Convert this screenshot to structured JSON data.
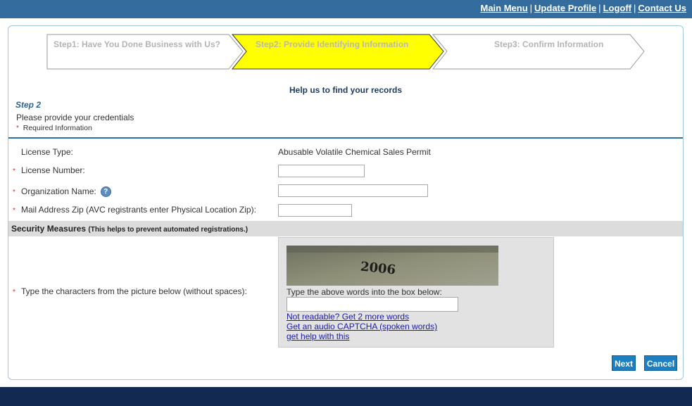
{
  "topnav": {
    "links": [
      "Main Menu",
      "Update Profile",
      "Logoff",
      "Contact Us"
    ],
    "separator": "|"
  },
  "steps": [
    {
      "label": "Step1: Have You Done Business with Us?",
      "state": "done"
    },
    {
      "label": "Step2: Provide Identifying Information",
      "state": "active",
      "color": "#ffff00"
    },
    {
      "label": "Step3: Confirm Information",
      "state": "pending"
    }
  ],
  "main": {
    "help_title": "Help us to find your records",
    "step_label": "Step 2",
    "instructions": "Please provide your credentials",
    "required_marker": "*",
    "required_info": "Required Information"
  },
  "form": {
    "license_type_label": "License Type:",
    "license_type_value": "Abusable Volatile Chemical Sales Permit",
    "license_number_label": "License Number:",
    "license_number_value": "",
    "org_name_label": "Organization Name:",
    "org_name_value": "",
    "zip_label": "Mail Address Zip (AVC registrants enter Physical Location Zip):",
    "zip_value": ""
  },
  "security": {
    "title": "Security Measures",
    "subtitle": "(This helps to prevent automated registrations.)",
    "captcha_label": "Type the characters from the picture below (without spaces):",
    "captcha_text": "2006",
    "captcha_instructions": "Type the above words into the box below:",
    "captcha_value": "",
    "links": [
      "Not readable? Get 2 more words",
      "Get an audio CAPTCHA (spoken words)",
      "get help with this"
    ]
  },
  "buttons": {
    "next": "Next",
    "cancel": "Cancel"
  },
  "colors": {
    "header": "#356c9e",
    "footer": "#122a52",
    "accent": "#1b7fc1",
    "active_step": "#ffff00"
  }
}
